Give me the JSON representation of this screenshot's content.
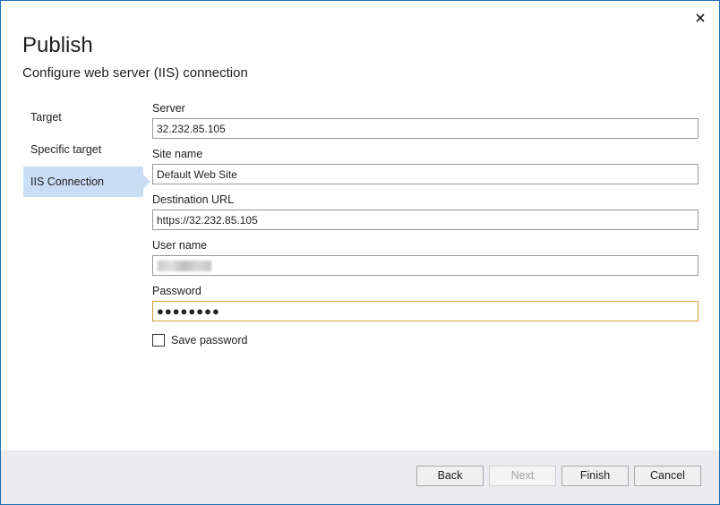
{
  "dialog": {
    "title": "Publish",
    "subtitle": "Configure web server (IIS) connection"
  },
  "nav": {
    "items": [
      {
        "label": "Target"
      },
      {
        "label": "Specific target"
      },
      {
        "label": "IIS Connection",
        "selected": true
      }
    ]
  },
  "form": {
    "server": {
      "label": "Server",
      "value": "32.232.85.105"
    },
    "site_name": {
      "label": "Site name",
      "value": "Default Web Site"
    },
    "destination_url": {
      "label": "Destination URL",
      "value": "https://32.232.85.105"
    },
    "user_name": {
      "label": "User name",
      "value": ""
    },
    "password": {
      "label": "Password",
      "value": "●●●●●●●●"
    },
    "save_password": {
      "label": "Save password",
      "checked": false
    }
  },
  "footer": {
    "back_label": "Back",
    "next_label": "Next",
    "finish_label": "Finish",
    "cancel_label": "Cancel"
  },
  "colors": {
    "accent": "#1f6fb5",
    "nav_selected": "#c9def5",
    "focus_border": "#d89d3c",
    "footer_bg": "#ececf0"
  }
}
